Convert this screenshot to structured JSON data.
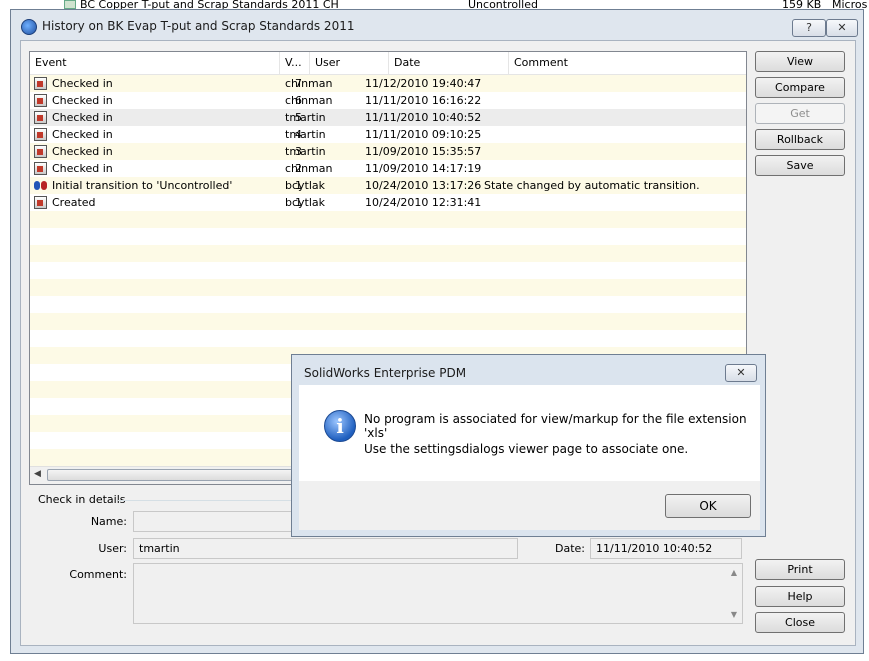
{
  "background": {
    "file_name": "BC Copper T-put and Scrap Standards 2011 CH",
    "state": "Uncontrolled",
    "size": "159 KB",
    "app": "Micros"
  },
  "dialog": {
    "title": "History on BK Evap T-put and Scrap Standards 2011",
    "help_btn": "?",
    "close_btn": "✕"
  },
  "list": {
    "headers": {
      "event": "Event",
      "version": "V...",
      "user": "User",
      "date": "Date",
      "comment": "Comment"
    },
    "rows": [
      {
        "event": "Checked in",
        "version": "7",
        "user": "chinman",
        "date": "11/12/2010 19:40:47",
        "comment": ""
      },
      {
        "event": "Checked in",
        "version": "6",
        "user": "chinman",
        "date": "11/11/2010 16:16:22",
        "comment": ""
      },
      {
        "event": "Checked in",
        "version": "5",
        "user": "tmartin",
        "date": "11/11/2010 10:40:52",
        "comment": ""
      },
      {
        "event": "Checked in",
        "version": "4",
        "user": "tmartin",
        "date": "11/11/2010 09:10:25",
        "comment": ""
      },
      {
        "event": "Checked in",
        "version": "3",
        "user": "tmartin",
        "date": "11/09/2010 15:35:57",
        "comment": ""
      },
      {
        "event": "Checked in",
        "version": "2",
        "user": "chinman",
        "date": "11/09/2010 14:17:19",
        "comment": ""
      },
      {
        "event": "Initial transition to 'Uncontrolled'",
        "version": "1",
        "user": "bcytlak",
        "date": "10/24/2010 13:17:26",
        "comment": "State changed by automatic transition."
      },
      {
        "event": "Created",
        "version": "1",
        "user": "bcytlak",
        "date": "10/24/2010 12:31:41",
        "comment": ""
      }
    ]
  },
  "buttons": {
    "view": "View",
    "compare": "Compare",
    "get": "Get",
    "rollback": "Rollback",
    "save": "Save",
    "print": "Print",
    "help": "Help",
    "close": "Close"
  },
  "details": {
    "group_title": "Check in details",
    "name_label": "Name:",
    "name_value": "",
    "user_label": "User:",
    "user_value": "tmartin",
    "date_label": "Date:",
    "date_value": "11/11/2010 10:40:52",
    "comment_label": "Comment:",
    "comment_value": ""
  },
  "message": {
    "title": "SolidWorks Enterprise PDM",
    "close_btn": "✕",
    "line1": "No program is associated for view/markup for the file extension 'xls'",
    "line2": "Use the settingsdialogs viewer page to associate one.",
    "ok": "OK",
    "icon_glyph": "i"
  }
}
